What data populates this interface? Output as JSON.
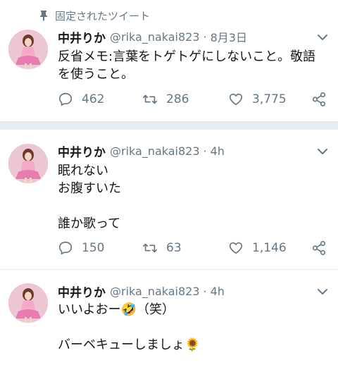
{
  "pinned_label": "固定されたツイート",
  "tweets": [
    {
      "name": "中井りか",
      "handle": "@rika_nakai823",
      "separator": "·",
      "time": "8月3日",
      "text": "反省メモ:言葉をトゲトゲにしないこと。敬語\nを使うこと。",
      "replies": "462",
      "retweets": "286",
      "likes": "3,775"
    },
    {
      "name": "中井りか",
      "handle": "@rika_nakai823",
      "separator": "·",
      "time": "4h",
      "text": "眠れない\nお腹すいた\n\n誰か歌って",
      "replies": "150",
      "retweets": "63",
      "likes": "1,146"
    },
    {
      "name": "中井りか",
      "handle": "@rika_nakai823",
      "separator": "·",
      "time": "4h",
      "text": "いいよおー🤣（笑）\n\nバーベキューしましょ🌻"
    }
  ]
}
